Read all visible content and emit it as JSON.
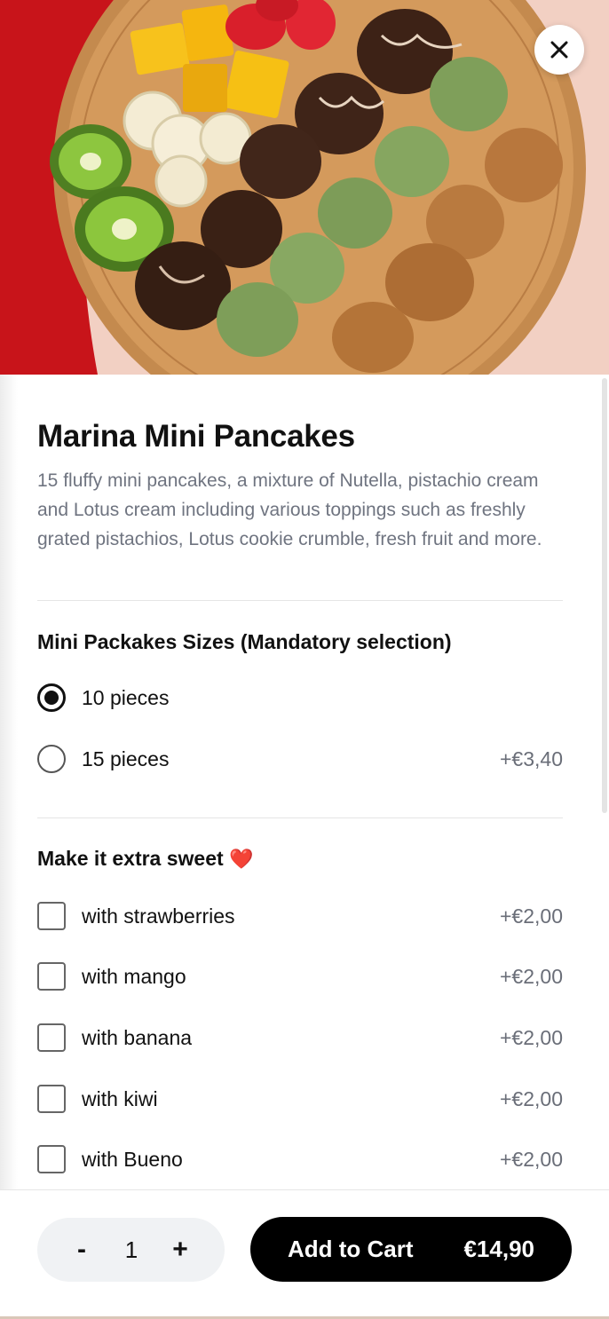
{
  "product": {
    "title": "Marina Mini Pancakes",
    "description": "15 fluffy mini pancakes, a mixture of Nutella, pistachio cream and Lotus cream including various toppings such as freshly grated pistachios, Lotus cookie crumble, fresh fruit and more."
  },
  "hero": {
    "image": "product-photo",
    "close_icon": "close-icon"
  },
  "sizes": {
    "title": "Mini Packakes Sizes (Mandatory selection)",
    "options": [
      {
        "label": "10 pieces",
        "price": "",
        "selected": true
      },
      {
        "label": "15 pieces",
        "price": "+€3,40",
        "selected": false
      }
    ]
  },
  "extras": {
    "title": "Make it extra sweet",
    "emoji": "❤️",
    "options": [
      {
        "label": "with strawberries",
        "price": "+€2,00",
        "checked": false
      },
      {
        "label": "with mango",
        "price": "+€2,00",
        "checked": false
      },
      {
        "label": "with banana",
        "price": "+€2,00",
        "checked": false
      },
      {
        "label": "with kiwi",
        "price": "+€2,00",
        "checked": false
      },
      {
        "label": "with Bueno",
        "price": "+€2,00",
        "checked": false
      }
    ]
  },
  "footer": {
    "minus": "-",
    "quantity": "1",
    "plus": "+",
    "add_label": "Add to Cart",
    "total": "€14,90"
  },
  "colors": {
    "accent": "#000000",
    "muted_text": "#6f7480",
    "hero_red": "#c8141a"
  }
}
